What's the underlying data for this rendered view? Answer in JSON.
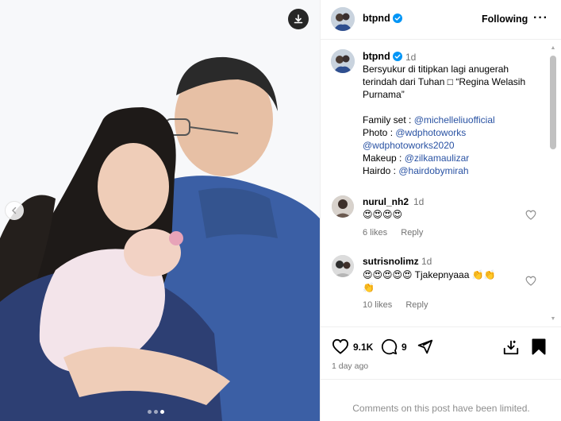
{
  "post": {
    "author": "btpnd",
    "follow_status": "Following",
    "more_label": "···"
  },
  "caption": {
    "author": "btpnd",
    "time": "1d",
    "lines": [
      {
        "text": "Bersyukur di titipkan lagi anugerah"
      },
      {
        "text": "terindah dari Tuhan □ “Regina Welasih"
      },
      {
        "text": "Purnama”"
      },
      {
        "text": ""
      },
      {
        "prefix": "Family set : ",
        "mention": "@michelleliuofficial"
      },
      {
        "prefix": "Photo : ",
        "mention": "@wdphotoworks"
      },
      {
        "prefix": "",
        "mention": "@wdphotoworks2020"
      },
      {
        "prefix": "Makeup : ",
        "mention": "@zilkamaulizar"
      },
      {
        "prefix": "Hairdo : ",
        "mention": "@hairdobymirah"
      }
    ]
  },
  "comments": [
    {
      "username": "nurul_nh2",
      "time": "1d",
      "text": "😍😍😍😍",
      "likes": "6 likes",
      "reply": "Reply"
    },
    {
      "username": "sutrisnolimz",
      "time": "1d",
      "text": "😍😍😍😍😍 Tjakepnyaaa 👏👏",
      "text2": "👏",
      "likes": "10 likes",
      "reply": "Reply"
    }
  ],
  "actions": {
    "like_count": "9.1K",
    "comment_count": "9",
    "posted": "1 day ago"
  },
  "footer": {
    "limited": "Comments on this post have been limited."
  },
  "carousel": {
    "slides": 3,
    "active": 3
  },
  "colors": {
    "mention": "#2952a3",
    "verified": "#0095f6",
    "muted": "#737373"
  }
}
